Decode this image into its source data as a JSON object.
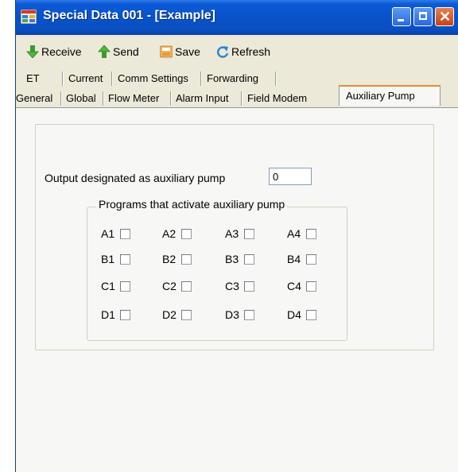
{
  "window": {
    "title": "Special Data 001 - [Example]",
    "icon": "window-grid-icon"
  },
  "toolbar": {
    "receive_label": "Receive",
    "send_label": "Send",
    "save_label": "Save",
    "refresh_label": "Refresh"
  },
  "tabs": {
    "row1": [
      "ET",
      "Current",
      "Comm Settings",
      "Forwarding"
    ],
    "row2": [
      "General",
      "Global",
      "Flow Meter",
      "Alarm Input",
      "Field Modem",
      "Auxiliary Pump"
    ],
    "active": "Auxiliary Pump"
  },
  "panel": {
    "output_label": "Output designated as auxiliary pump",
    "output_value": "0",
    "programs_legend": "Programs that activate auxiliary pump",
    "programs": [
      [
        "A1",
        "A2",
        "A3",
        "A4"
      ],
      [
        "B1",
        "B2",
        "B3",
        "B4"
      ],
      [
        "C1",
        "C2",
        "C3",
        "C4"
      ],
      [
        "D1",
        "D2",
        "D3",
        "D4"
      ]
    ]
  },
  "colors": {
    "titlebar": "#0852c9",
    "window_bg": "#ece9d8",
    "active_tab_accent": "#e68b2c"
  }
}
